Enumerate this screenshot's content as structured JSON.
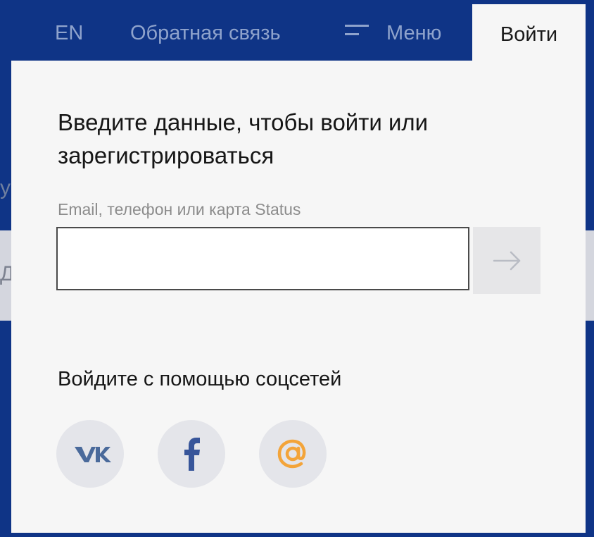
{
  "nav": {
    "lang": "EN",
    "feedback": "Обратная связь",
    "menu": "Меню",
    "login": "Войти"
  },
  "login_panel": {
    "title": "Введите данные, чтобы войти или зарегистрироваться",
    "field_label": "Email, телефон или карта Status",
    "field_value": "",
    "social_title": "Войдите с помощью соцсетей"
  },
  "social": [
    {
      "name": "vk",
      "icon": "vk-icon"
    },
    {
      "name": "facebook",
      "icon": "facebook-icon"
    },
    {
      "name": "mail.ru",
      "icon": "mailru-icon"
    }
  ],
  "colors": {
    "header_bg": "#0f3486",
    "panel_bg": "#f6f6f6",
    "nav_text": "#8fa3cc",
    "vk_blue": "#4a6a9b",
    "facebook_blue": "#37559a",
    "mailru_orange": "#f3a43a"
  }
}
